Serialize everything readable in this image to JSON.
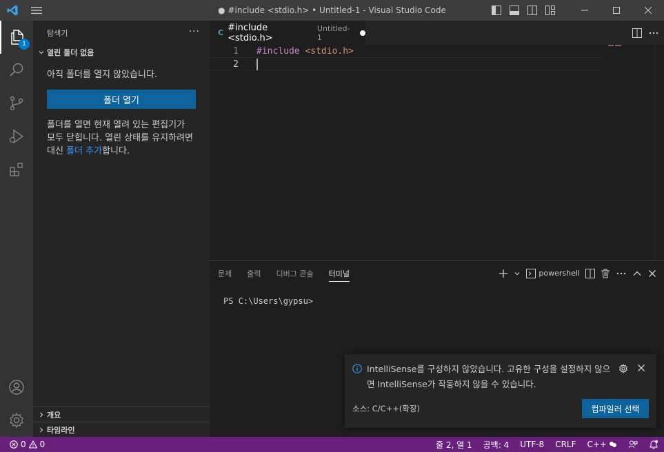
{
  "window": {
    "title": "● #include <stdio.h> • Untitled-1 - Visual Studio Code"
  },
  "activity_bar": {
    "explorer_badge": "1"
  },
  "sidebar": {
    "header": "탐색기",
    "more": "···",
    "section_title": "열린 폴더 없음",
    "no_folder_text": "아직 폴더를 열지 않았습니다.",
    "open_folder_button": "폴더 열기",
    "info_text_before": "폴더를 열면 현재 열려 있는 편집기가 모두 닫힙니다. 열린 상태를 유지하려면 대신 ",
    "info_link": "폴더 추가",
    "info_text_after": "합니다.",
    "outline_section": "개요",
    "timeline_section": "타임라인"
  },
  "editor": {
    "tab": {
      "icon": "C",
      "title": "#include <stdio.h>",
      "description": "Untitled-1"
    },
    "lines": [
      {
        "number": "1",
        "keyword": "#include",
        "string": "<stdio.h>"
      },
      {
        "number": "2",
        "keyword": "",
        "string": ""
      }
    ]
  },
  "panel": {
    "tabs": [
      "문제",
      "출력",
      "디버그 콘솔",
      "터미널"
    ],
    "active_tab": "터미널",
    "terminal_name": "powershell",
    "terminal_prompt": "PS C:\\Users\\gypsu>"
  },
  "notification": {
    "message": "IntelliSense를 구성하지 않았습니다. 고유한 구성을 설정하지 않으면 IntelliSense가 작동하지 않을 수 있습니다.",
    "source": "소스: C/C++(확장)",
    "button": "컴파일러 선택"
  },
  "status_bar": {
    "errors": "0",
    "warnings": "0",
    "position": "줄 2, 열 1",
    "spaces": "공백: 4",
    "encoding": "UTF-8",
    "eol": "CRLF",
    "language": "C++",
    "color": "#68217a"
  },
  "colors": {
    "accent_button": "#0e639c",
    "link": "#3794ff",
    "keyword": "#c586c0",
    "string": "#ce9178"
  }
}
